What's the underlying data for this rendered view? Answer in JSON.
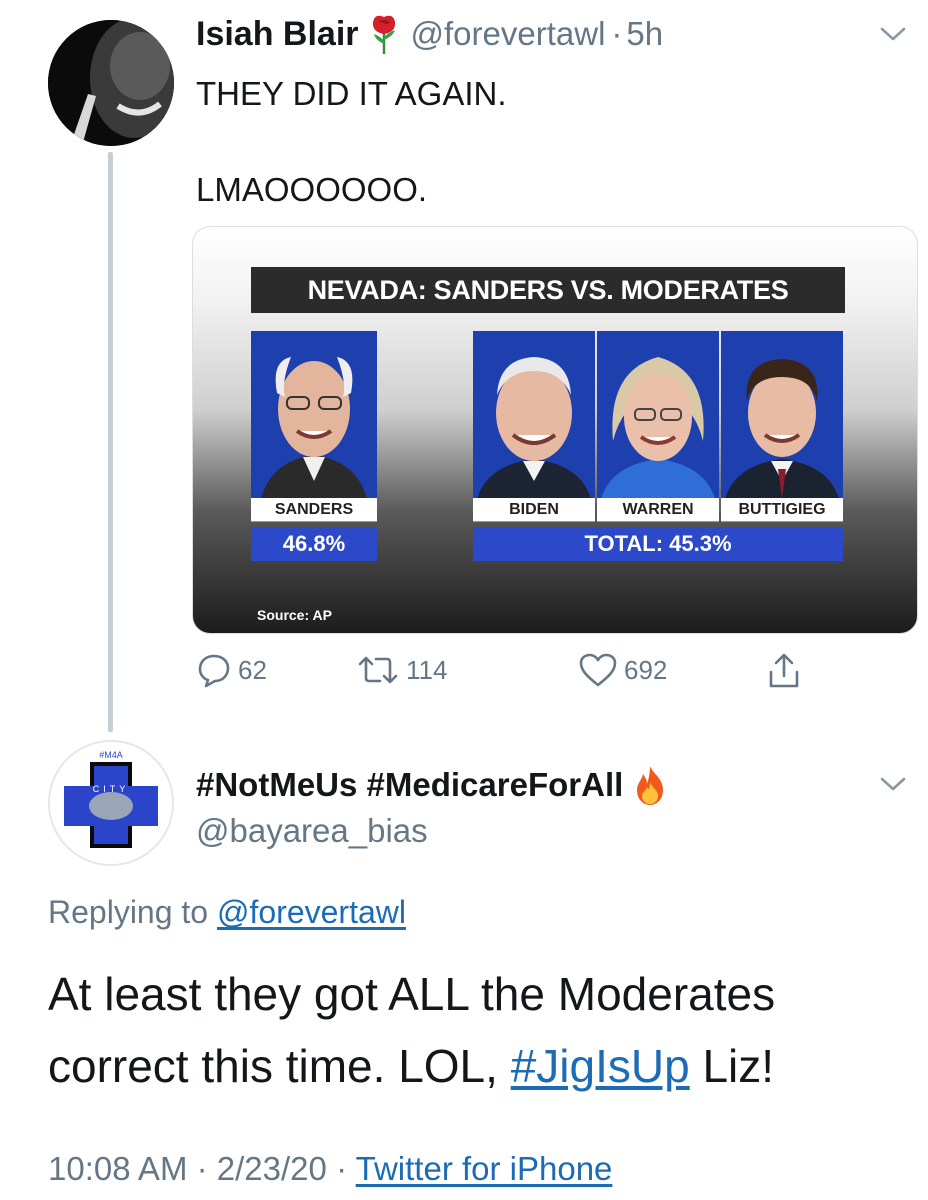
{
  "tweet": {
    "author_name": "Isiah Blair",
    "author_emoji_icon": "rose-icon",
    "handle": "@forevertawl",
    "separator": "·",
    "time": "5h",
    "text_line1": "THEY DID IT AGAIN.",
    "text_line2": "LMAOOOOOO.",
    "media": {
      "banner": "NEVADA: SANDERS VS. MODERATES",
      "candidates": [
        "SANDERS",
        "BIDEN",
        "WARREN",
        "BUTTIGIEG"
      ],
      "sanders_pct": "46.8%",
      "moderates_total": "TOTAL: 45.3%",
      "source": "Source: AP",
      "accent_blue": "#2b49c9"
    },
    "actions": {
      "replies": "62",
      "retweets": "114",
      "likes": "692"
    }
  },
  "reply": {
    "author_name": "#NotMeUs #MedicareForAll",
    "author_emoji_icon": "fire-icon",
    "handle": "@bayarea_bias",
    "avatar_text": "#M4A",
    "avatar_text2": "CITY",
    "replying_prefix": "Replying to",
    "replying_to": "@forevertawl",
    "text_part1": "At least they got ALL the Moderates correct this time. LOL, ",
    "hashtag": "#JigIsUp",
    "text_part2": " Liz!",
    "time": "10:08 AM",
    "date": "2/23/20",
    "client": "Twitter for iPhone"
  },
  "colors": {
    "text": "#14171a",
    "muted": "#657786",
    "link": "#1b6cb5"
  }
}
